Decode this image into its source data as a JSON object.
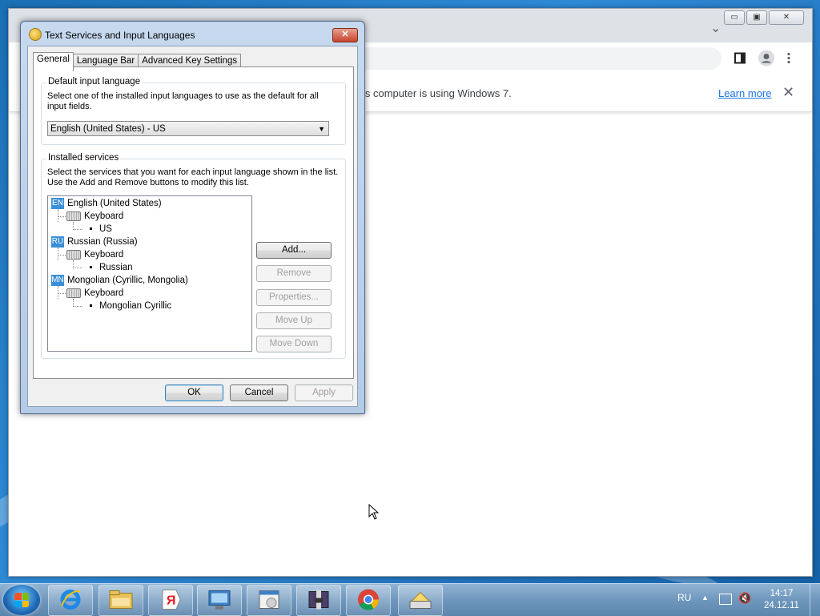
{
  "browser": {
    "infobar": {
      "text": "is computer is using Windows 7.",
      "learn_more": "Learn more",
      "close_glyph": "✕"
    },
    "window_buttons": {
      "minimize": "▭",
      "restore": "▣",
      "close": "✕"
    },
    "tab_dropdown_glyph": "⌄"
  },
  "dialog": {
    "title": "Text Services and Input Languages",
    "close_glyph": "✕",
    "tabs": [
      "General",
      "Language Bar",
      "Advanced Key Settings"
    ],
    "active_tab": "General",
    "default_language": {
      "group_label": "Default input language",
      "description": "Select one of the installed input languages to use as the default for all input fields.",
      "selected": "English (United States) - US"
    },
    "installed_services": {
      "group_label": "Installed services",
      "description": "Select the services that you want for each input language shown in the list. Use the Add and Remove buttons to modify this list.",
      "languages": [
        {
          "code": "EN",
          "name": "English (United States)",
          "category": "Keyboard",
          "layout": "US"
        },
        {
          "code": "RU",
          "name": "Russian (Russia)",
          "category": "Keyboard",
          "layout": "Russian"
        },
        {
          "code": "MN",
          "name": "Mongolian (Cyrillic, Mongolia)",
          "category": "Keyboard",
          "layout": "Mongolian Cyrillic"
        }
      ],
      "buttons": {
        "add": "Add...",
        "remove": "Remove",
        "properties": "Properties...",
        "move_up": "Move Up",
        "move_down": "Move Down"
      }
    },
    "footer_buttons": {
      "ok": "OK",
      "cancel": "Cancel",
      "apply": "Apply"
    }
  },
  "taskbar": {
    "pinned": [
      "internet-explorer-icon",
      "file-explorer-icon",
      "yandex-icon",
      "control-panel-icon",
      "media-center-icon",
      "archive-icon",
      "chrome-icon",
      "keyboard-settings-icon"
    ],
    "tray": {
      "language": "RU",
      "time": "14:17",
      "date": "24.12.11"
    }
  },
  "colors": {
    "accent": "#3b8fd6",
    "link": "#1a73e8",
    "taskbar": "#6f97bd"
  }
}
